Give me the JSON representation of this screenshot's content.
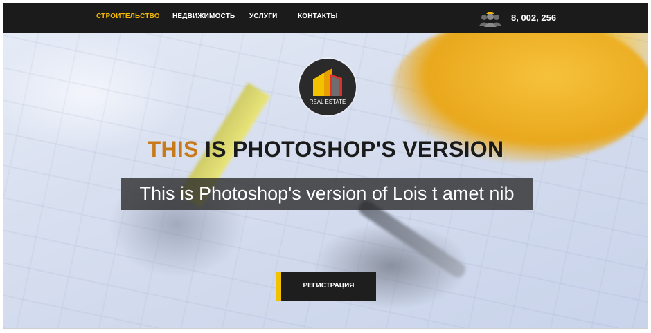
{
  "nav": {
    "items": [
      {
        "label": "СТРОИТЕЛЬСТВО",
        "active": true
      },
      {
        "label": "НЕДВИЖИМОСТЬ",
        "active": false
      },
      {
        "label": "УСЛУГИ",
        "active": false
      },
      {
        "label": "КОНТАКТЫ",
        "active": false
      }
    ],
    "users_icon": "users-group-icon",
    "counter": "8, 002, 256"
  },
  "logo": {
    "text": "REAL ESTATE",
    "icon": "building-logo-icon"
  },
  "hero": {
    "headline_accent": "THIS",
    "headline_rest": " IS PHOTOSHOP'S VERSION",
    "subline": "This is Photoshop's version  of Lois t amet nib",
    "register_label": "РЕГИСТРАЦИЯ"
  },
  "colors": {
    "nav_bg": "#1b1b1b",
    "accent_yellow": "#f2b705",
    "headline_accent": "#c87a1a",
    "button_bg": "#1e1e1e",
    "button_stripe": "#f2c200"
  }
}
